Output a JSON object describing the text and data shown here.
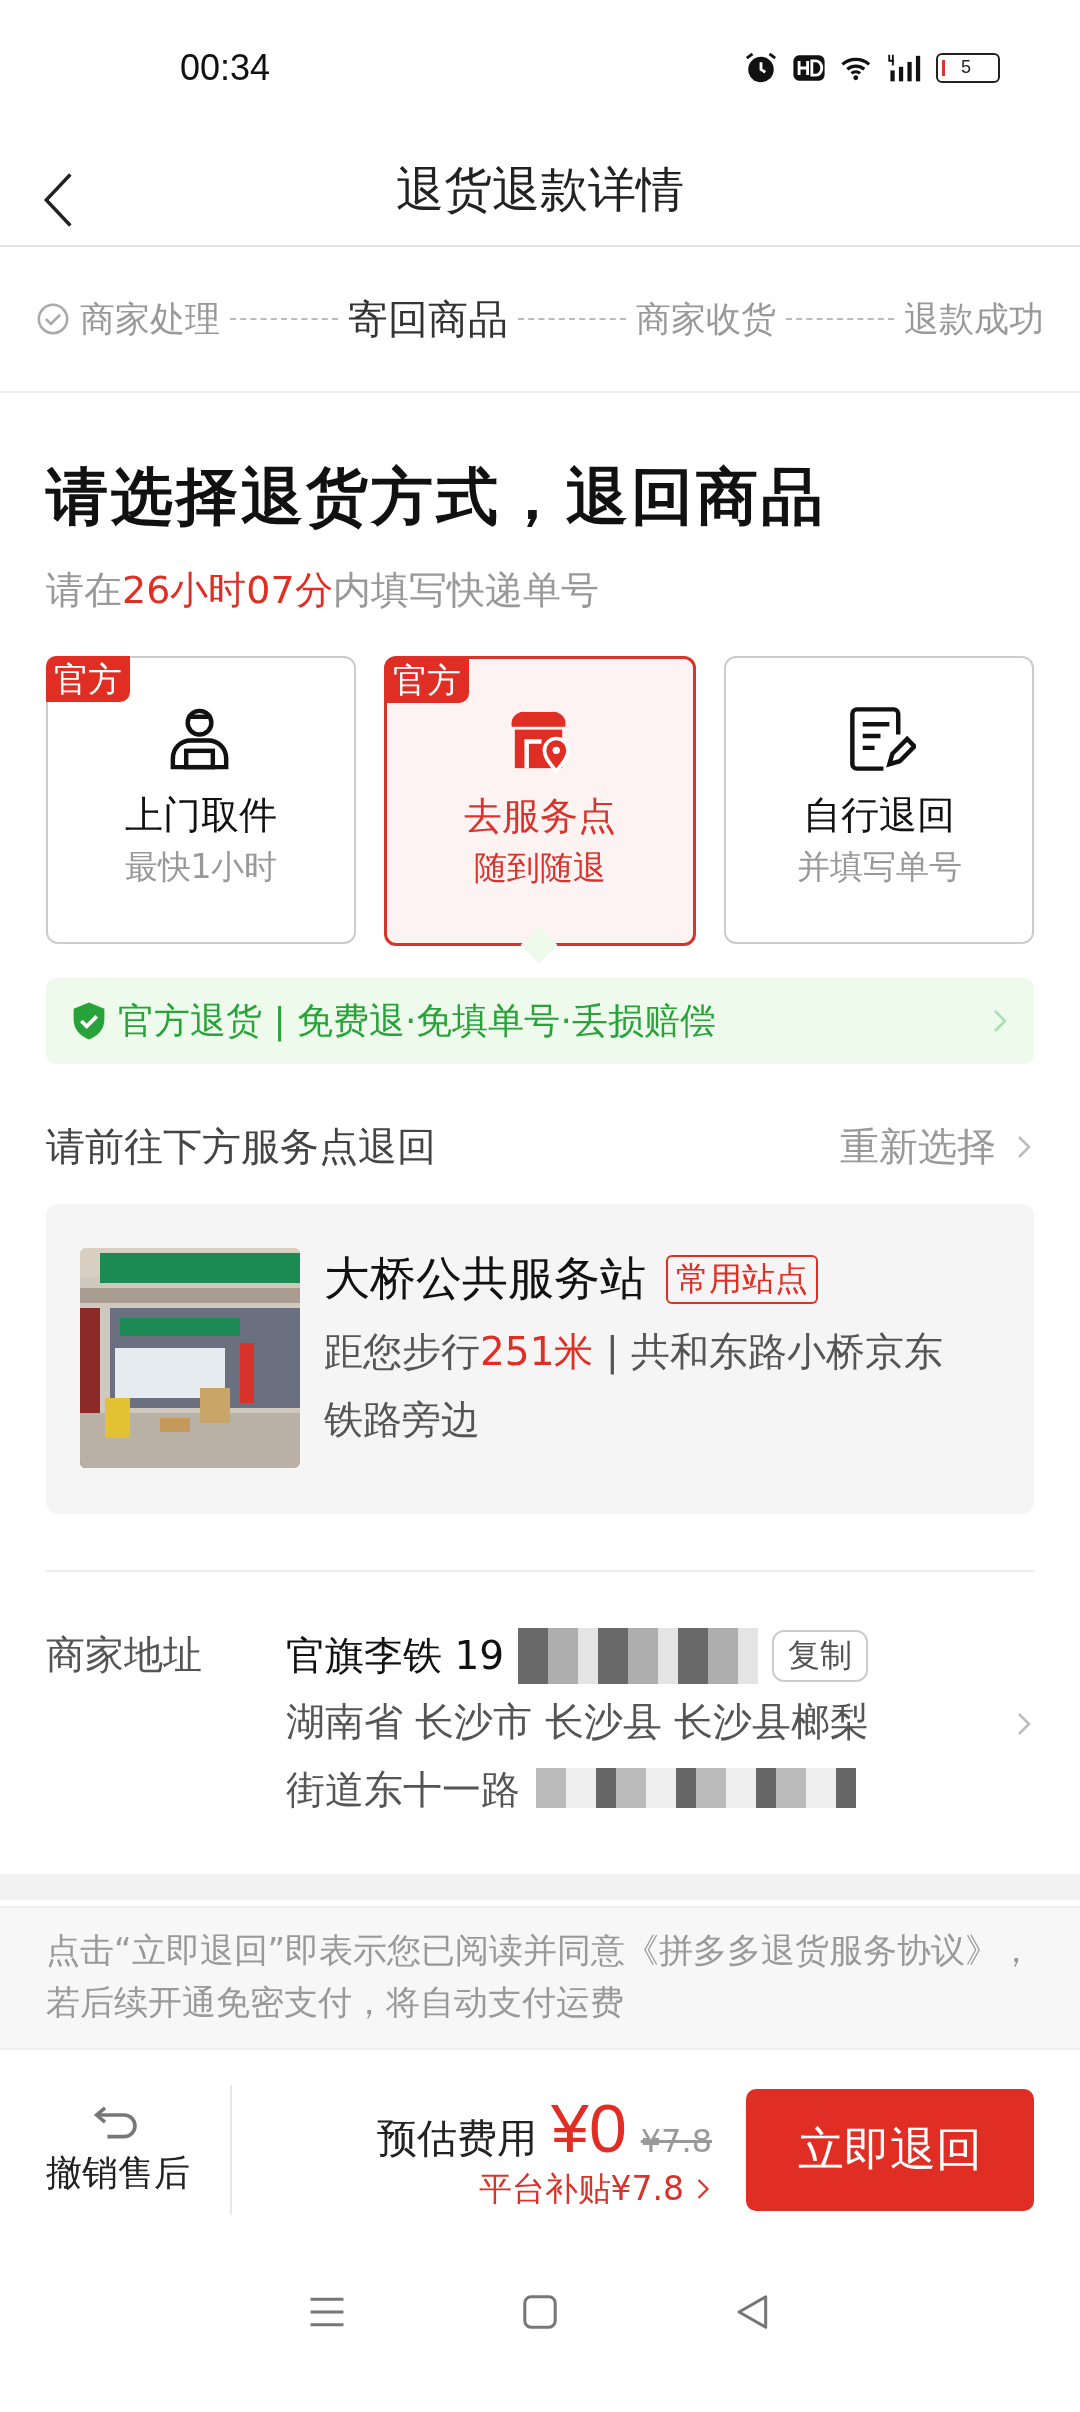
{
  "status_bar": {
    "time": "00:34",
    "battery": "5"
  },
  "header": {
    "title": "退货退款详情"
  },
  "steps": [
    {
      "label": "商家处理",
      "done": true,
      "selected": false
    },
    {
      "label": "寄回商品",
      "done": false,
      "selected": true
    },
    {
      "label": "商家收货",
      "done": false,
      "selected": false
    },
    {
      "label": "退款成功",
      "done": false,
      "selected": false
    }
  ],
  "heading": "请选择退货方式，退回商品",
  "deadline": "请在**26小时07分**内填写快递单号",
  "methods": [
    {
      "kind": "courier",
      "badge": "官方",
      "title": "上门取件",
      "subtitle": "最快1小时",
      "selected": false
    },
    {
      "kind": "store",
      "badge": "官方",
      "title": "去服务点",
      "subtitle": "随到随退",
      "selected": true
    },
    {
      "kind": "self",
      "title": "自行退回",
      "subtitle": "并填写单号",
      "selected": false
    }
  ],
  "banner": "官方退货 | 免费退·免填单号·丢损赔偿",
  "station_section": {
    "title": "请前往下方服务点退回",
    "action": "重新选择"
  },
  "station": {
    "name": "大桥公共服务站",
    "tag": "常用站点",
    "distance_prefix": "距您步行",
    "distance": "251米",
    "address": "| 共和东路小桥京东铁路旁边"
  },
  "merchant": {
    "label": "商家地址",
    "name": "官旗李铁 19",
    "copy": "复制",
    "address_lines": [
      "湖南省 长沙市 长沙县 长沙县榔梨",
      "街道东十一路"
    ]
  },
  "agreement": "点击“立即退回”即表示您已阅读并同意《拼多多退货服务协议》，若后续开通免密支付，将自动支付运费",
  "footer": {
    "cancel": "撤销售后",
    "fee_label": "预估费用",
    "fee": "¥0",
    "original_fee": "¥7.8",
    "subsidy": "平台补贴¥7.8",
    "submit": "立即退回"
  }
}
